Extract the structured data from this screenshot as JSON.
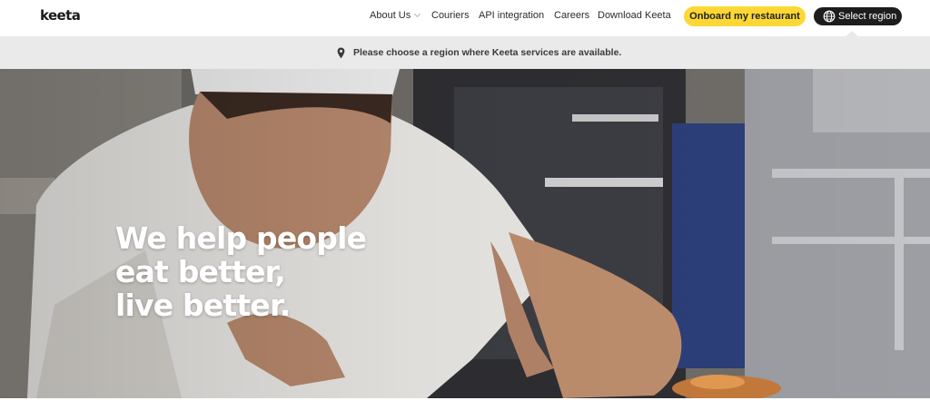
{
  "header": {
    "logo_text": "keeta",
    "nav": [
      {
        "label": "About Us",
        "has_dropdown": true
      },
      {
        "label": "Couriers"
      },
      {
        "label": "API integration"
      },
      {
        "label": "Careers"
      },
      {
        "label": "Download Keeta"
      }
    ],
    "onboard_label": "Onboard my restaurant",
    "region_label": "Select region",
    "region_icon": "globe-icon"
  },
  "notice": {
    "icon": "location-pin-icon",
    "text": "Please choose a region where Keeta services are available."
  },
  "hero": {
    "headline": [
      "We help people",
      "eat better,",
      "live better."
    ],
    "image": "chef-plating-food-photo"
  },
  "colors": {
    "brand_yellow": "#fdd835",
    "dark_button": "#1d1d1d",
    "notice_bg": "#eaeaea"
  }
}
